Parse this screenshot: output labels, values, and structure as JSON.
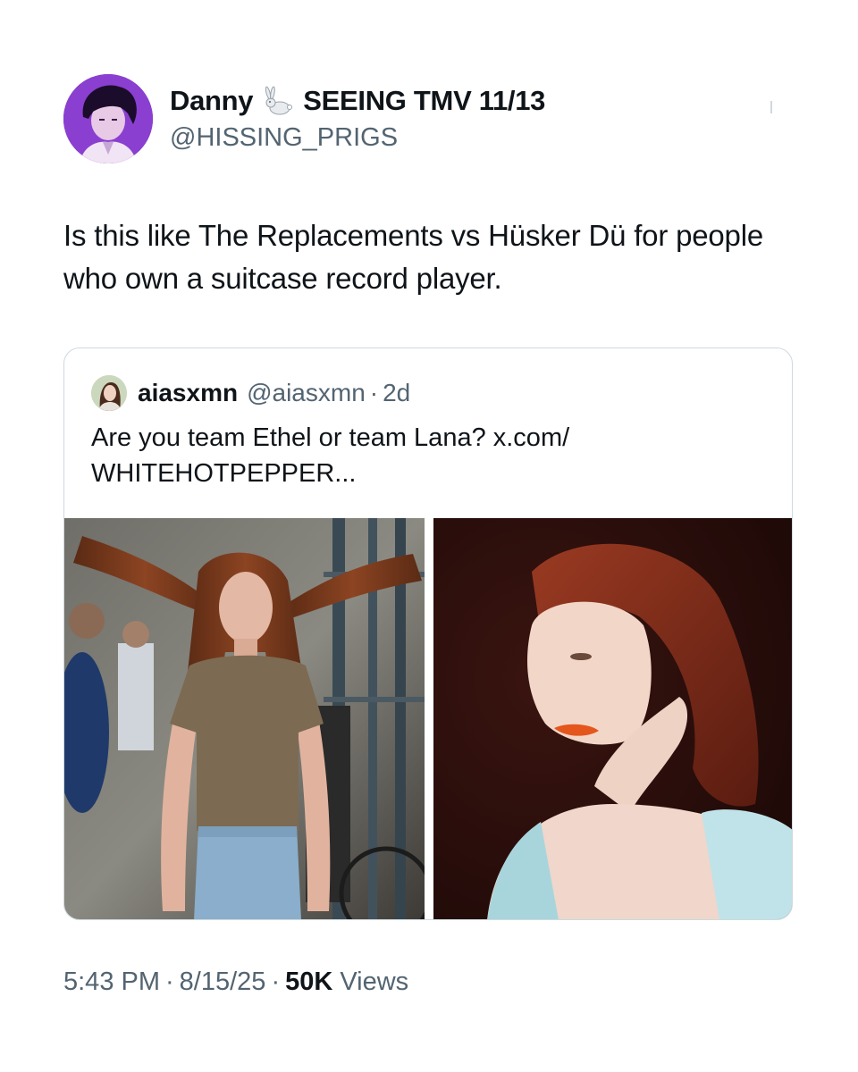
{
  "author": {
    "display_name": "Danny",
    "name_suffix": "SEEING TMV 11/13",
    "handle": "@HISSING_PRIGS",
    "name_emoji": "rabbit-icon"
  },
  "tweet": {
    "text": "Is this like The Replacements vs Hüsker Dü for people who own a suitcase record player."
  },
  "quoted_tweet": {
    "display_name": "aiasxmn",
    "handle": "@aiasxmn",
    "separator": "·",
    "time": "2d",
    "text_line1": "Are you team Ethel or team Lana? x.com/",
    "text_line2": "WHITEHOTPEPPER..."
  },
  "meta": {
    "time": "5:43 PM",
    "date": "8/15/25",
    "separator": "·",
    "views_count": "50K",
    "views_label": "Views"
  },
  "colors": {
    "text_primary": "#0f1419",
    "text_secondary": "#536471",
    "border": "#cfd9de",
    "avatar_bg": "#7a2fb8"
  }
}
